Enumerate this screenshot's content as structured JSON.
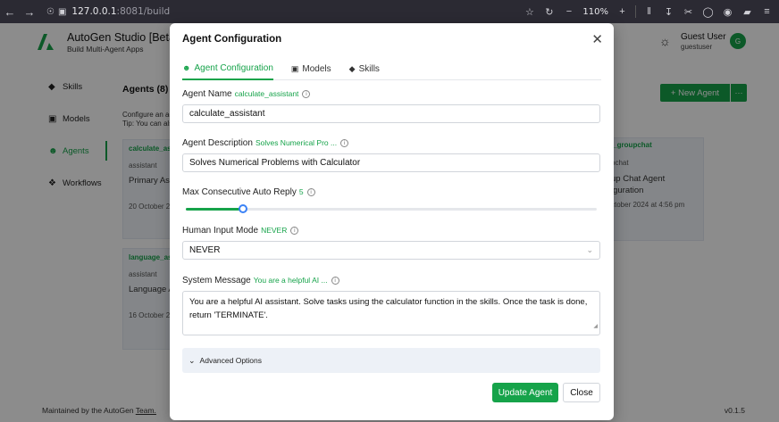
{
  "browser": {
    "url_host": "127.0.0.1",
    "url_rest": ":8081/build",
    "zoom": "110%"
  },
  "app": {
    "title": "AutoGen Studio [Beta]",
    "subtitle": "Build Multi-Agent Apps",
    "user_name": "Guest User",
    "user_id": "guestuser",
    "avatar_letter": "G",
    "brand_color": "#16a34a"
  },
  "sidebar": {
    "items": [
      {
        "label": "Skills",
        "icon": "skills-icon"
      },
      {
        "label": "Models",
        "icon": "models-icon"
      },
      {
        "label": "Agents",
        "icon": "agents-icon",
        "active": true
      },
      {
        "label": "Workflows",
        "icon": "workflows-icon"
      }
    ]
  },
  "agents_page": {
    "heading": "Agents (8)",
    "new_agent_label": "+ New Agent",
    "more_label": "···",
    "config_text": "Configure an ag",
    "tip_text": "Tip: You can als",
    "cards": [
      {
        "name": "calculate_assi",
        "type": "assistant",
        "desc": "Primary Ass",
        "date": "20 October 20"
      },
      {
        "name": "language_ass",
        "type": "assistant",
        "desc": "Language A",
        "date": "16 October 20"
      }
    ],
    "groupchat_card": {
      "name": "i_groupchat",
      "type": "pchat",
      "desc_line1": "up Chat Agent",
      "desc_line2": "iguration",
      "date": "ctober 2024 at 4:56 pm"
    }
  },
  "footer": {
    "prefix": "Maintained by the AutoGen ",
    "link": "Team.",
    "version": "v0.1.5"
  },
  "modal": {
    "title": "Agent Configuration",
    "tabs": [
      {
        "label": "Agent Configuration",
        "active": true
      },
      {
        "label": "Models"
      },
      {
        "label": "Skills"
      }
    ],
    "agent_name": {
      "label": "Agent Name",
      "hint": "calculate_assistant",
      "value": "calculate_assistant"
    },
    "agent_description": {
      "label": "Agent Description",
      "hint": "Solves Numerical Pro ...",
      "value": "Solves Numerical Problems with Calculator"
    },
    "max_auto_reply": {
      "label": "Max Consecutive Auto Reply",
      "hint": "5",
      "value": 5,
      "fraction": 0.14
    },
    "human_input_mode": {
      "label": "Human Input Mode",
      "hint": "NEVER",
      "value": "NEVER"
    },
    "system_message": {
      "label": "System Message",
      "hint": "You are a helpful AI ...",
      "value": "You are a helpful AI assistant. Solve tasks using the calculator function in the skills. Once the task is done, return 'TERMINATE'."
    },
    "advanced_label": "Advanced Options",
    "update_label": "Update Agent",
    "close_label": "Close",
    "info_glyph": "i"
  }
}
